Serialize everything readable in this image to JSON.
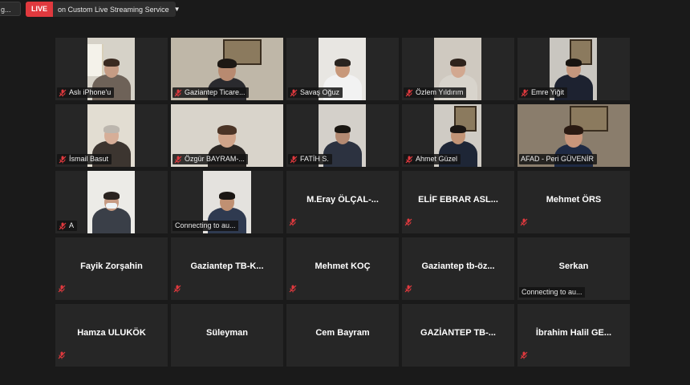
{
  "meeting": {
    "pill_text": "g..."
  },
  "live": {
    "badge": "LIVE",
    "service": "on Custom Live Streaming Service",
    "caret_icon": "chevron-down-icon"
  },
  "colors": {
    "background": "#1a1a1a",
    "tile": "#262626",
    "live_red": "#e0393e",
    "active_speaker": "#cfe060",
    "mic_muted": "#e0393e"
  },
  "participants": [
    {
      "name": "Aslı iPhone'u",
      "video": true,
      "muted": true
    },
    {
      "name": "Gaziantep Ticare...",
      "video": true,
      "muted": true
    },
    {
      "name": "Savaş Oğuz",
      "video": true,
      "muted": true
    },
    {
      "name": "Özlem Yıldırım",
      "video": true,
      "muted": true
    },
    {
      "name": "Emre Yiğit",
      "video": true,
      "muted": true
    },
    {
      "name": "İsmail Basut",
      "video": true,
      "muted": true
    },
    {
      "name": "Özgür BAYRAM-...",
      "video": true,
      "muted": true
    },
    {
      "name": "FATİH S.",
      "video": true,
      "muted": true
    },
    {
      "name": "Ahmet Güzel",
      "video": true,
      "muted": true
    },
    {
      "name": "AFAD - Peri GÜVENİR",
      "video": true,
      "muted": false,
      "active": true
    },
    {
      "name": "A",
      "video": true,
      "muted": true
    },
    {
      "name": "Connecting to au...",
      "video": true,
      "connecting": true
    },
    {
      "name": "M.Eray  ÖLÇAL-...",
      "video": false,
      "muted": true
    },
    {
      "name": "ELİF EBRAR ASL...",
      "video": false,
      "muted": true
    },
    {
      "name": "Mehmet  ÖRS",
      "video": false,
      "muted": true
    },
    {
      "name": "Fayik Zorşahin",
      "video": false,
      "muted": true
    },
    {
      "name": "Gaziantep  TB-K...",
      "video": false,
      "muted": true
    },
    {
      "name": "Mehmet KOÇ",
      "video": false,
      "muted": true
    },
    {
      "name": "Gaziantep  tb-öz...",
      "video": false,
      "muted": true
    },
    {
      "name": "Serkan",
      "video": false,
      "connecting_label": "Connecting to au..."
    },
    {
      "name": "Hamza ULUKÖK",
      "video": false,
      "muted": true
    },
    {
      "name": "Süleyman",
      "video": false,
      "muted": false
    },
    {
      "name": "Cem Bayram",
      "video": false,
      "muted": false
    },
    {
      "name": "GAZİANTEP TB-...",
      "video": false,
      "muted": false
    },
    {
      "name": "İbrahim  Halil  GE...",
      "video": false,
      "muted": true
    }
  ]
}
